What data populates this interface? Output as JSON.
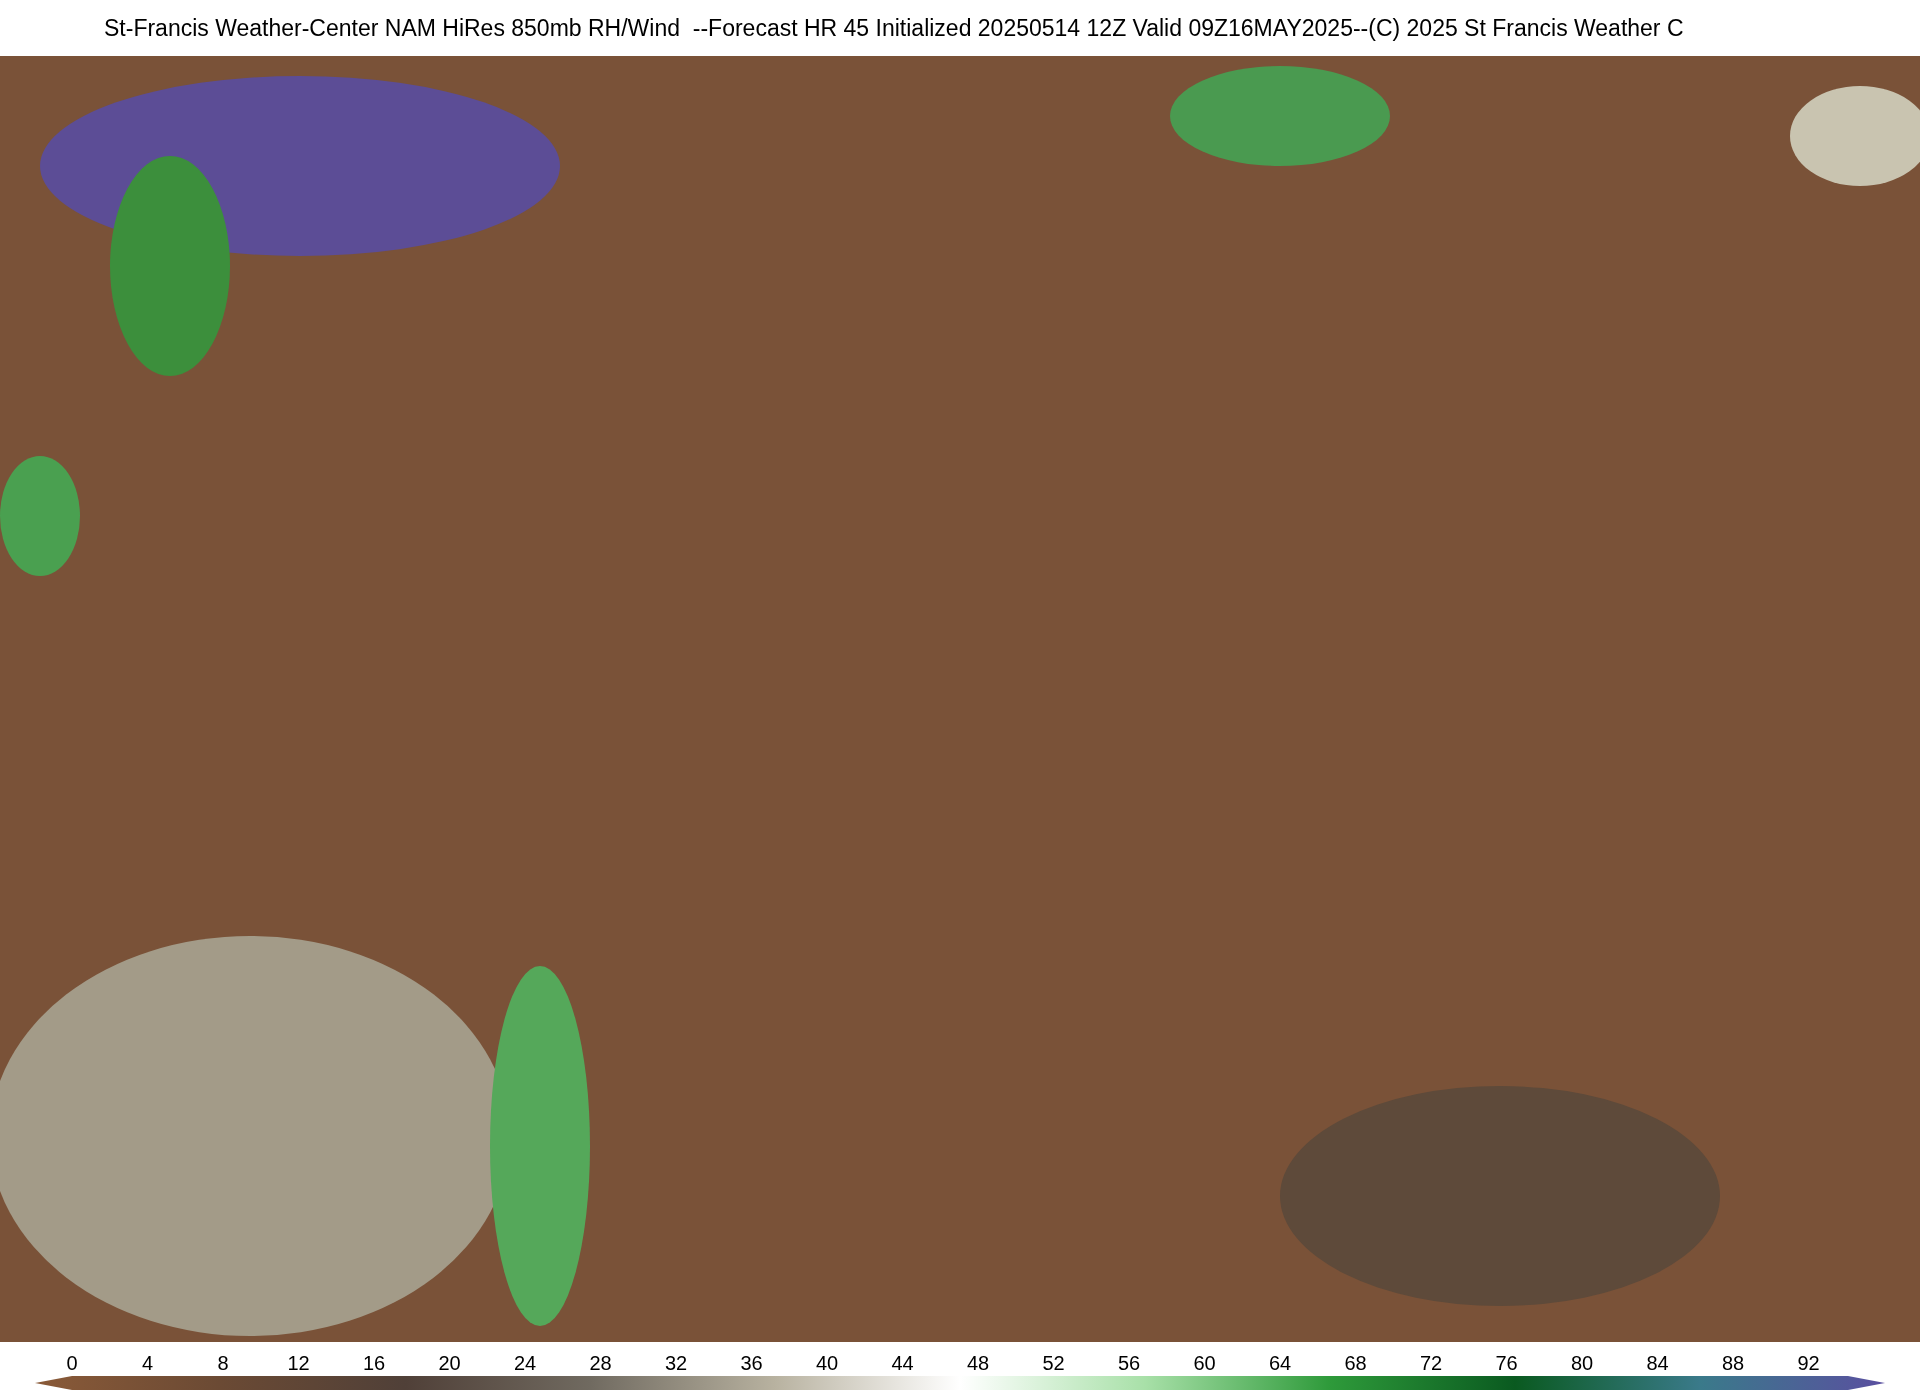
{
  "title": "St-Francis Weather-Center NAM HiRes 850mb RH/Wind  --Forecast HR 45 Initialized 20250514 12Z Valid 09Z16MAY2025--(C) 2025 St Francis Weather C",
  "colorbar": {
    "ticks": [
      "0",
      "4",
      "8",
      "12",
      "16",
      "20",
      "24",
      "28",
      "32",
      "36",
      "40",
      "44",
      "48",
      "52",
      "56",
      "60",
      "64",
      "68",
      "72",
      "76",
      "80",
      "84",
      "88",
      "92"
    ]
  }
}
